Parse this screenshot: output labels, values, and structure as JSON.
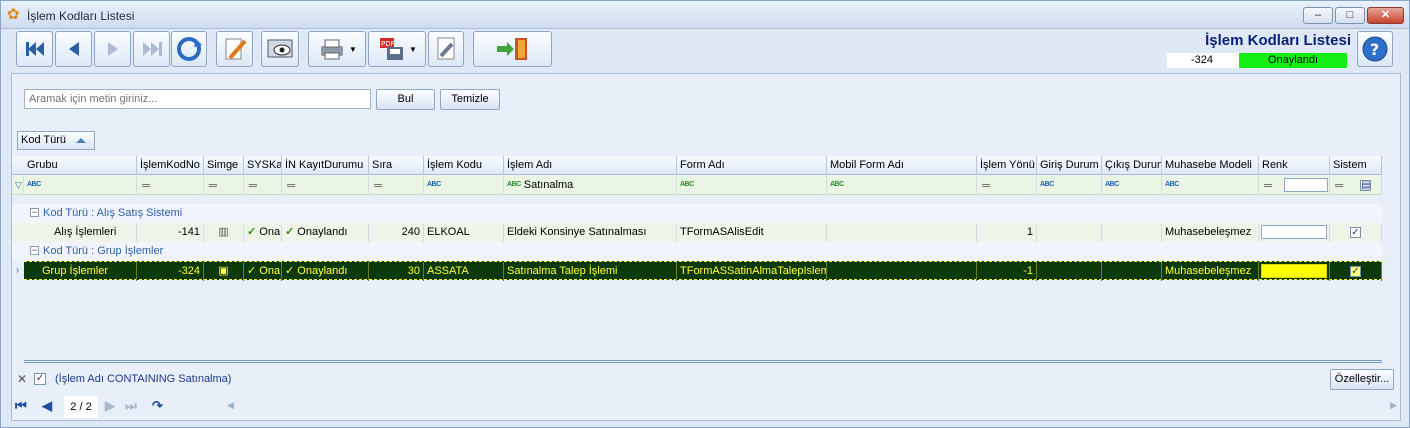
{
  "window": {
    "title": "İşlem Kodları Listesi"
  },
  "toolbar": {
    "buttons": [
      "first-record-icon",
      "prev-record-icon",
      "next-record-icon",
      "last-record-icon",
      "refresh-icon",
      "edit-icon",
      "preview-icon",
      "print-icon",
      "export-pdf-icon",
      "settings-icon",
      "exit-icon",
      "help-icon"
    ]
  },
  "header": {
    "title": "İşlem Kodları Listesi",
    "code": "-324",
    "status": "Onaylandı",
    "status_color": "#14f014"
  },
  "search": {
    "placeholder": "Aramak için metin giriniz...",
    "value": "",
    "find_label": "Bul",
    "clear_label": "Temizle"
  },
  "group_chip": {
    "label": "Kod Türü"
  },
  "grid": {
    "columns": [
      "Grubu",
      "İşlemKodNo",
      "Simge",
      "SYSKayıt",
      "İN KayıtDurumu",
      "Sıra",
      "İşlem Kodu",
      "İşlem Adı",
      "Form Adı",
      "Mobil Form Adı",
      "İşlem Yönü",
      "Giriş Durum",
      "Çıkış Durum",
      "Muhasebe Modeli",
      "Renk",
      "Sistem"
    ],
    "filter_value": "Satınalma",
    "groups": [
      {
        "label": "Kod Türü : Alış Satış Sistemi"
      },
      {
        "label": "Kod Türü : Grup İşlemler"
      }
    ],
    "rows": [
      {
        "grubu": "Alış İşlemleri",
        "kodno": "-141",
        "sys": "Ona",
        "durum": "Onaylandı",
        "sira": "240",
        "kod": "ELKOAL",
        "ad": "Eldeki Konsinye Satınalması",
        "form": "TFormASAlisEdit",
        "mobil": "",
        "yon": "1",
        "giris": "",
        "cikis": "",
        "muhasebe": "Muhasebeleşmez",
        "renk": "#ffffff",
        "sistem": "✓"
      },
      {
        "grubu": "Grup İşlemler",
        "kodno": "-324",
        "sys": "Ona",
        "durum": "Onaylandı",
        "sira": "30",
        "kod": "ASSATA",
        "ad": "Satınalma Talep İşlemi",
        "form": "TFormASSatinAlmaTalepIslemE",
        "mobil": "",
        "yon": "-1",
        "giris": "",
        "cikis": "",
        "muhasebe": "Muhasebeleşmez",
        "renk": "#ffff00",
        "sistem": "✓"
      }
    ]
  },
  "filter_status": {
    "text": "(İşlem Adı CONTAINING Satınalma)",
    "customize_label": "Özelleştir..."
  },
  "navigator": {
    "page": "2 / 2"
  }
}
